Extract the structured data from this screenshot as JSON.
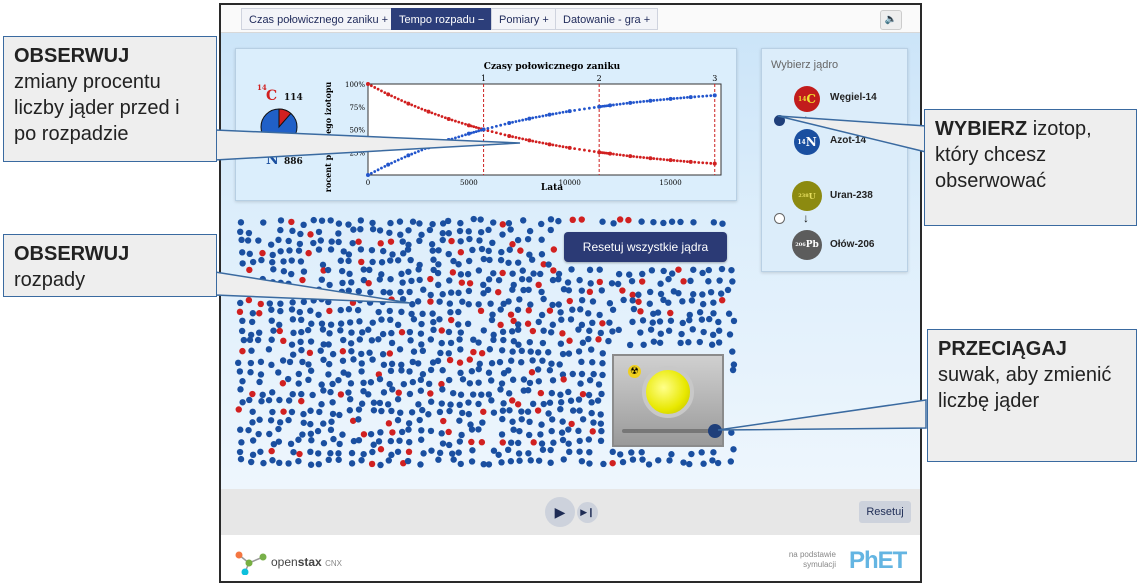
{
  "tabs": [
    {
      "label": "Czas połowicznego zaniku +",
      "active": false
    },
    {
      "label": "Tempo rozpadu −",
      "active": true
    },
    {
      "label": "Pomiary +",
      "active": false
    },
    {
      "label": "Datowanie - gra +",
      "active": false
    }
  ],
  "sound_icon": "speaker-icon",
  "legend": {
    "parent_symbol": "C",
    "parent_mass": "14",
    "parent_count": "114",
    "daughter_symbol": "N",
    "daughter_mass": "14",
    "daughter_count": "886",
    "pie_parent_fraction": 0.114
  },
  "chart_data": {
    "type": "scatter",
    "title": "Czasy połowicznego zaniku",
    "xlabel": "Lata",
    "ylabel": "procent pozostałego izotopu",
    "ylabel_visible": "rocent poz…lego izotopu",
    "xlim": [
      0,
      17500
    ],
    "ylim": [
      0,
      100
    ],
    "x_ticks": [
      "0",
      "5000",
      "10000",
      "15000"
    ],
    "y_ticks": [
      "100%",
      "75%",
      "50%",
      "25%"
    ],
    "half_life_markers": {
      "labels": [
        "1",
        "2",
        "3"
      ],
      "x": [
        5730,
        11460,
        17190
      ]
    },
    "series": [
      {
        "color": "#d12020",
        "x": [
          0,
          1000,
          2000,
          3000,
          4000,
          5000,
          5730,
          7000,
          8000,
          9000,
          10000,
          11460,
          12000,
          13000,
          14000,
          15000,
          16000,
          17190
        ],
        "y": [
          100,
          88.6,
          78.5,
          69.6,
          61.6,
          54.6,
          50,
          42.9,
          38.0,
          33.7,
          29.8,
          25,
          23.5,
          20.7,
          18.4,
          16.3,
          14.4,
          12.5
        ]
      },
      {
        "color": "#2255cc",
        "x": [
          0,
          1000,
          2000,
          3000,
          4000,
          5000,
          5730,
          7000,
          8000,
          9000,
          10000,
          11460,
          12000,
          13000,
          14000,
          15000,
          16000,
          17190
        ],
        "y": [
          0,
          11.4,
          21.5,
          30.4,
          38.4,
          45.4,
          50,
          57.1,
          62.0,
          66.3,
          70.2,
          75,
          76.5,
          79.3,
          81.6,
          83.7,
          85.6,
          87.5
        ]
      }
    ]
  },
  "chooser": {
    "title": "Wybierz jądro",
    "options": [
      {
        "parent": "Węgiel-14",
        "parent_mass": "14",
        "parent_sym": "C",
        "daughter": "Azot-14",
        "daughter_mass": "14",
        "daughter_sym": "N",
        "selected": true
      },
      {
        "parent": "Uran-238",
        "parent_mass": "238",
        "parent_sym": "U",
        "daughter": "Ołów-206",
        "daughter_mass": "206",
        "daughter_sym": "Pb",
        "selected": false
      }
    ]
  },
  "reset_all_label": "Resetuj wszystkie jądra",
  "bucket_slider": 1.0,
  "controls": {
    "play_icon": "play-icon",
    "step_icon": "step-forward-icon",
    "reset_label": "Resetuj"
  },
  "footer": {
    "openstax_prefix": "open",
    "openstax_bold": "stax",
    "cnx": "CNX",
    "based_on": "na podstawie symulacji",
    "phet": "PhET"
  },
  "callouts": {
    "observe_percent": {
      "bold": "OBSERWUJ",
      "text": "zmiany procentu liczby jąder przed i po rozpadzie"
    },
    "observe_decay": {
      "bold": "OBSERWUJ",
      "text": "rozpady"
    },
    "select_isotope": {
      "bold": "WYBIERZ",
      "text": "izotop, który chcesz obserwować"
    },
    "drag_slider": {
      "bold": "PRZECIĄGAJ",
      "text": "suwak, aby zmienić liczbę jąder"
    }
  },
  "colors": {
    "tab_active": "#2c3e7a",
    "nucleus_parent": "#d12020",
    "nucleus_daughter": "#1a4fa0"
  }
}
